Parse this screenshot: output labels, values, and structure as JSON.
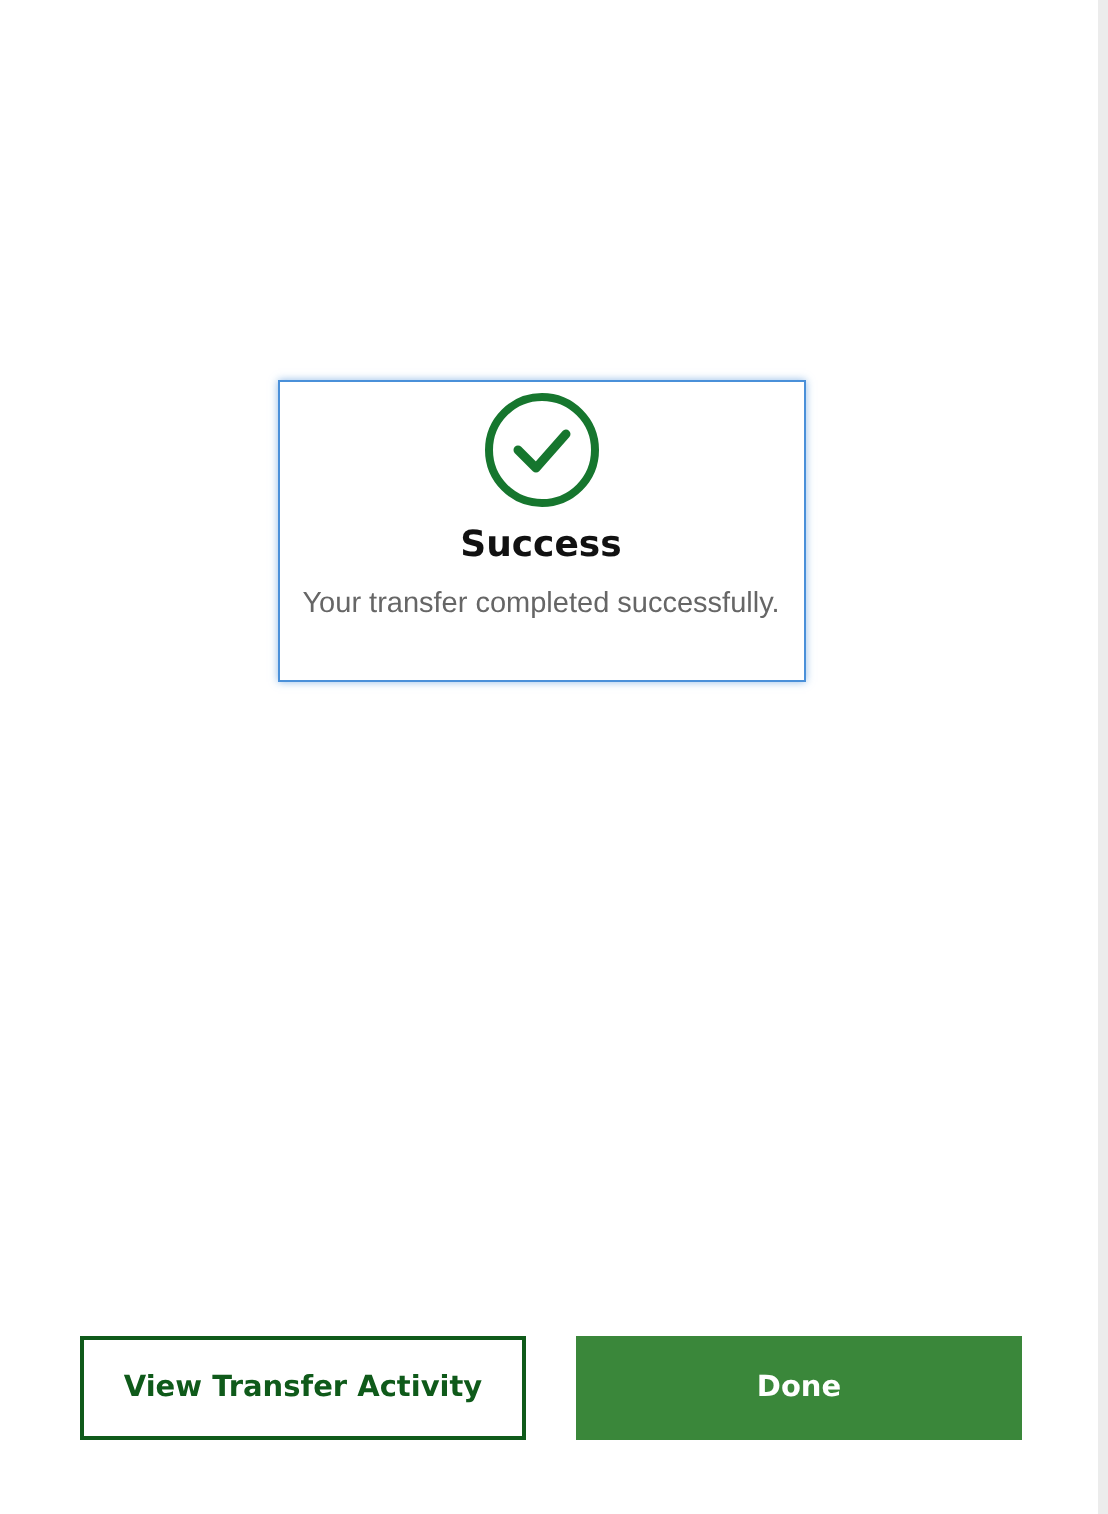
{
  "dialog": {
    "title": "Success",
    "message": "Your transfer completed successfully."
  },
  "buttons": [
    {
      "label": "View Transfer Activity",
      "kind": "outline"
    },
    {
      "label": "Done",
      "kind": "primary"
    }
  ]
}
